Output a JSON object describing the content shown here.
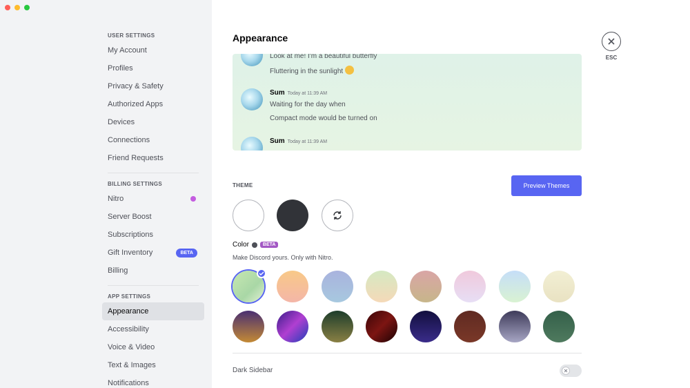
{
  "sidebar": {
    "sections": [
      {
        "header": "USER SETTINGS",
        "items": [
          "My Account",
          "Profiles",
          "Privacy & Safety",
          "Authorized Apps",
          "Devices",
          "Connections",
          "Friend Requests"
        ]
      },
      {
        "header": "BILLING SETTINGS",
        "items": [
          "Nitro",
          "Server Boost",
          "Subscriptions",
          "Gift Inventory",
          "Billing"
        ]
      },
      {
        "header": "APP SETTINGS",
        "items": [
          "Appearance",
          "Accessibility",
          "Voice & Video",
          "Text & Images",
          "Notifications"
        ]
      }
    ],
    "active_item": "Appearance",
    "gift_badge": "BETA"
  },
  "main": {
    "title": "Appearance",
    "esc_label": "ESC",
    "preview": {
      "line1": "Look at me! I'm a beautiful butterfly",
      "line2": "Fluttering in the sunlight",
      "msg1_author": "Sum",
      "msg1_time": "Today at 11:39 AM",
      "msg1_line1": "Waiting for the day when",
      "msg1_line2": "Compact mode would be turned on",
      "msg2_author": "Sum",
      "msg2_time": "Today at 11:39 AM"
    },
    "theme": {
      "label": "THEME",
      "preview_button": "Preview Themes",
      "options": [
        "light",
        "dark",
        "sync"
      ]
    },
    "color": {
      "label": "Color",
      "badge": "BETA",
      "subtitle": "Make Discord yours. Only with Nitro.",
      "selected_index": 0,
      "row1": [
        "linear-gradient(135deg,#c7e8b2,#a9d7a6 60%,#e3f1d4)",
        "linear-gradient(180deg,#f8c988,#f4b6a8)",
        "linear-gradient(180deg,#a9b3de,#a7c8df)",
        "linear-gradient(180deg,#d5e9c2,#f5d9b8)",
        "linear-gradient(180deg,#d9a5a6,#c7b68a)",
        "linear-gradient(180deg,#f0c9dc,#e7def5)",
        "linear-gradient(180deg,#c5def8,#d9f2d2)",
        "linear-gradient(180deg,#f2efd4,#e9e2c2)"
      ],
      "row2": [
        "linear-gradient(180deg,#4a2f72,#c48a35)",
        "linear-gradient(135deg,#3a1e8a,#b03fd1 50%,#1f3fb8)",
        "linear-gradient(180deg,#1d3d2b,#8a8044)",
        "linear-gradient(135deg,#3a0608,#7c1512 50%,#1a0204)",
        "linear-gradient(180deg,#120f3e,#3a2c8a)",
        "linear-gradient(180deg,#5f2a22,#7a3828)",
        "linear-gradient(180deg,#3e3b5a,#a7a6c4)",
        "linear-gradient(180deg,#34604a,#4f7a5e)"
      ]
    },
    "dark_sidebar": {
      "label": "Dark Sidebar",
      "enabled": false
    }
  }
}
